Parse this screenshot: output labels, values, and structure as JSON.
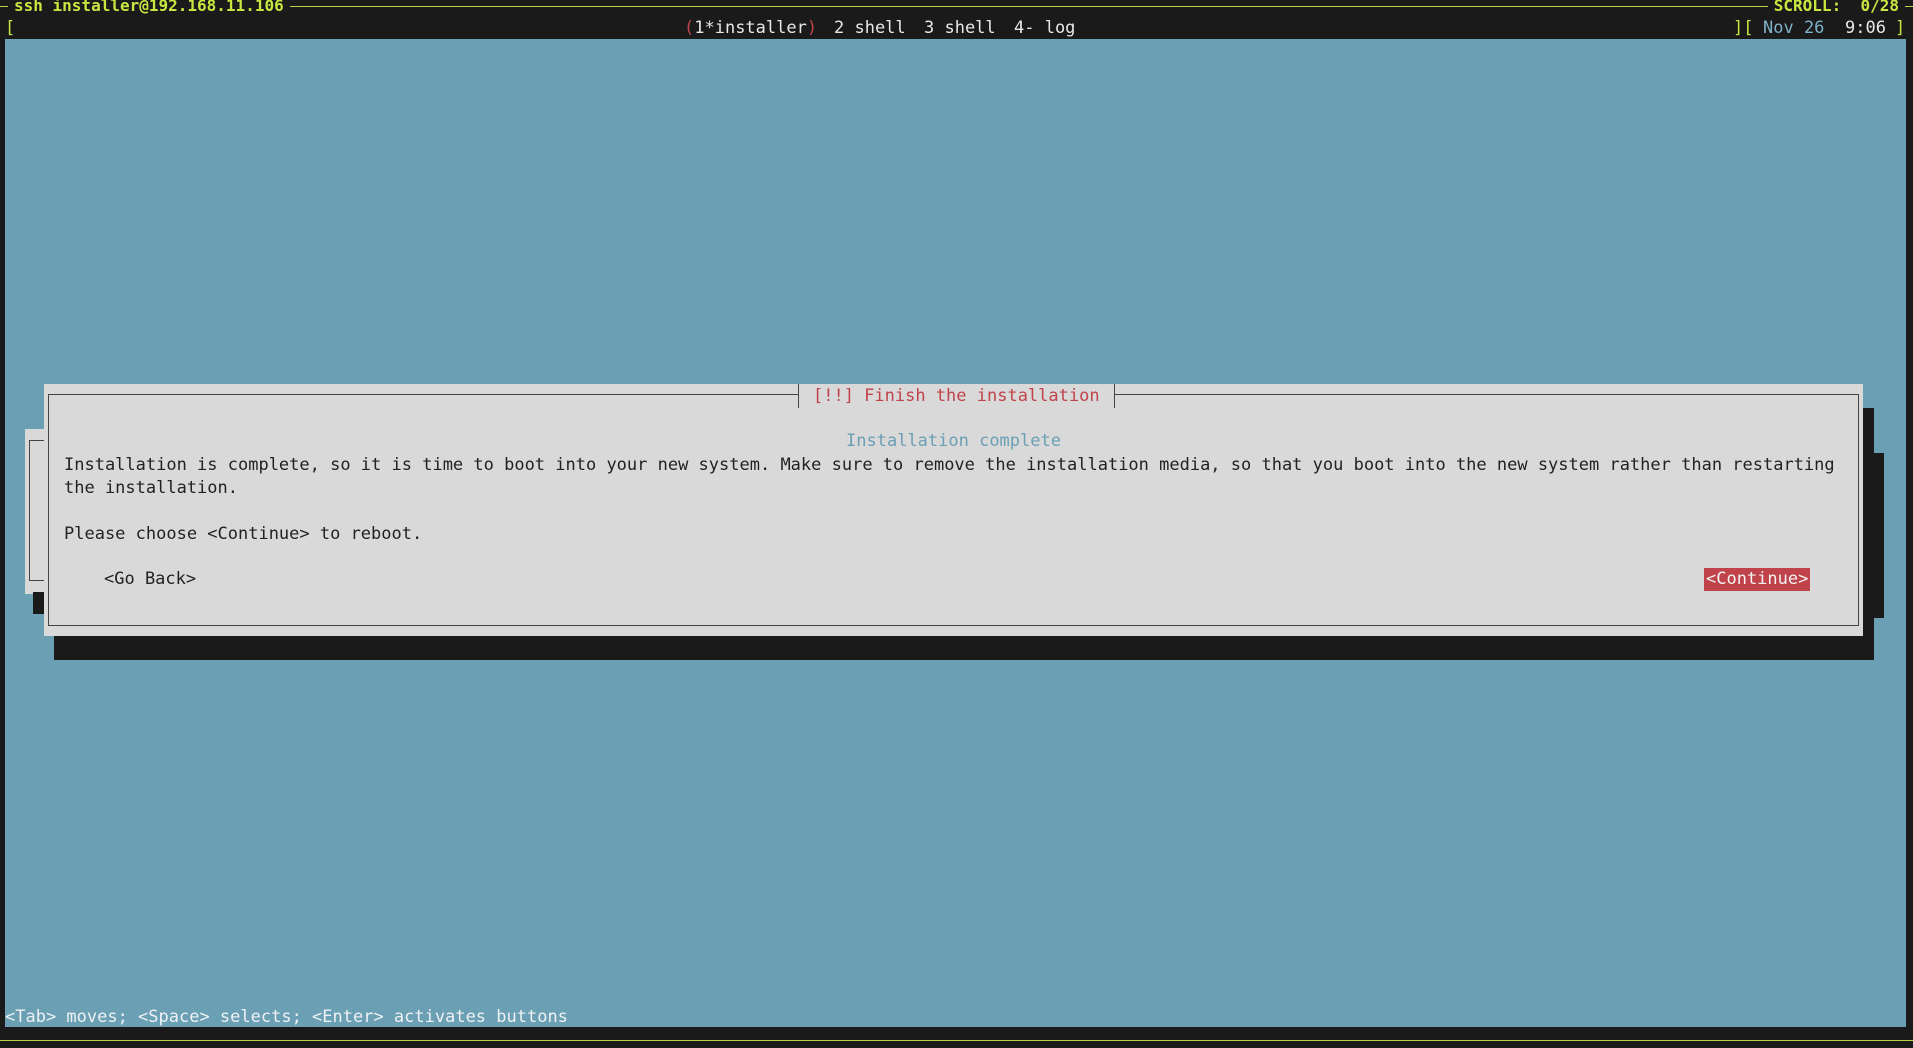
{
  "window": {
    "title": "ssh installer@192.168.11.106",
    "scroll_label": "SCROLL:  0/28"
  },
  "statusbar": {
    "left_bracket": "[",
    "tabs": [
      {
        "open": "(",
        "label": "1*installer",
        "close": ")",
        "active": true
      },
      {
        "label": "2 shell",
        "active": false
      },
      {
        "label": "3 shell",
        "active": false
      },
      {
        "label": "4- log",
        "active": false
      }
    ],
    "right_bracket_open": "][",
    "date": "Nov 26",
    "time": "9:06",
    "right_bracket_close": "]"
  },
  "dialog": {
    "title": "[!!] Finish the installation",
    "heading": "Installation complete",
    "body": "Installation is complete, so it is time to boot into your new system. Make sure to remove the installation media, so that you boot into the new system rather than restarting the installation.",
    "prompt": "Please choose <Continue> to reboot.",
    "go_back_label": "<Go Back>",
    "continue_label": "<Continue>"
  },
  "help": {
    "text": "<Tab> moves; <Space> selects; <Enter> activates buttons"
  },
  "colors": {
    "backdrop": "#6b9fb4",
    "dialog_bg": "#d9d9d9",
    "accent_red": "#c0434b",
    "status_green": "#c8e640"
  }
}
